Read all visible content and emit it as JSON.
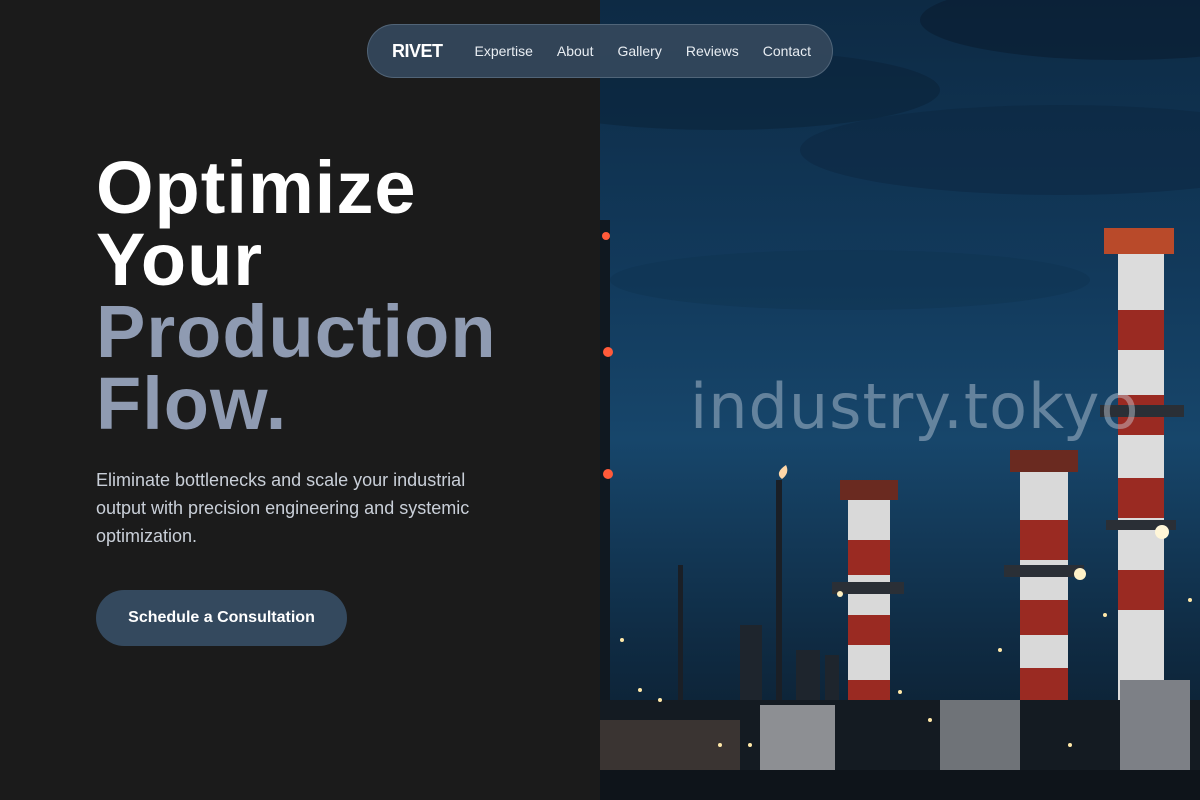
{
  "nav": {
    "logo": "RIVET",
    "links": [
      "Expertise",
      "About",
      "Gallery",
      "Reviews",
      "Contact"
    ]
  },
  "hero": {
    "title_line1": "Optimize",
    "title_line2": "Your",
    "title_line3": "Production",
    "title_line4": "Flow.",
    "subtitle": "Eliminate bottlenecks and scale your industrial output with precision engineering and systemic optimization.",
    "cta_label": "Schedule a Consultation"
  },
  "image": {
    "watermark": "industry.tokyo",
    "subject": "industrial-refinery-night-photo"
  },
  "colors": {
    "background": "#1b1b1b",
    "accent_muted": "#8f9bb2",
    "nav_bg": "#34485c",
    "button_bg": "#34495e"
  }
}
